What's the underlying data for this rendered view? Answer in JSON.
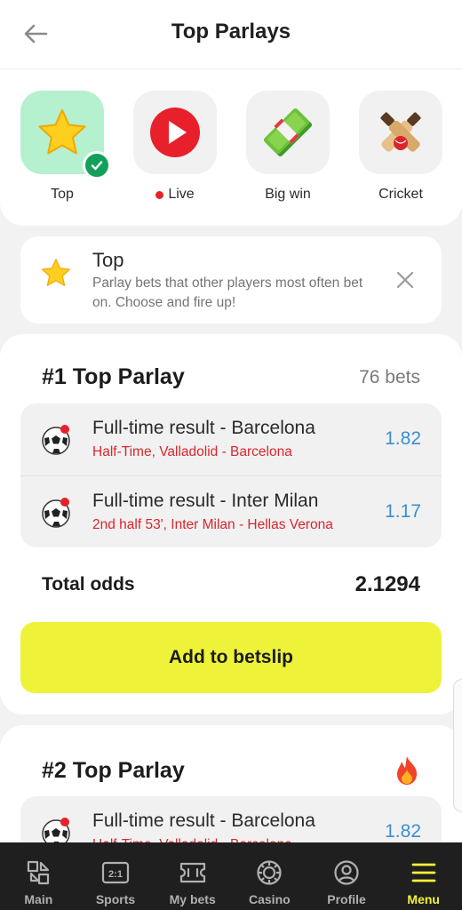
{
  "header": {
    "title": "Top Parlays",
    "back_icon": "arrow-left-icon"
  },
  "categories": [
    {
      "label": "Top",
      "icon": "star-icon",
      "active": true
    },
    {
      "label": "Live",
      "icon": "play-icon",
      "live_dot": true
    },
    {
      "label": "Big win",
      "icon": "money-stack-icon"
    },
    {
      "label": "Cricket",
      "icon": "cricket-icon"
    }
  ],
  "info": {
    "title": "Top",
    "description": "Parlay bets that other players most often bet on. Choose and fire up!",
    "icon": "star-icon"
  },
  "parlays": [
    {
      "title": "#1 Top Parlay",
      "bets_count": "76 bets",
      "bets": [
        {
          "title": "Full-time result - Barcelona",
          "subtitle": "Half-Time, Valladolid - Barcelona",
          "odds": "1.82"
        },
        {
          "title": "Full-time result - Inter Milan",
          "subtitle": "2nd half 53', Inter Milan - Hellas Verona",
          "odds": "1.17"
        }
      ],
      "total_label": "Total odds",
      "total_value": "2.1294",
      "add_label": "Add to betslip"
    },
    {
      "title": "#2 Top Parlay",
      "badge_icon": "fire-icon",
      "bets": [
        {
          "title": "Full-time result - Barcelona",
          "subtitle": "Half-Time, Valladolid - Barcelona",
          "odds": "1.82"
        }
      ]
    }
  ],
  "bottom_nav": [
    {
      "label": "Main",
      "icon": "main-icon"
    },
    {
      "label": "Sports",
      "icon": "sports-icon"
    },
    {
      "label": "My bets",
      "icon": "ticket-icon"
    },
    {
      "label": "Casino",
      "icon": "casino-chip-icon"
    },
    {
      "label": "Profile",
      "icon": "profile-icon"
    },
    {
      "label": "Menu",
      "icon": "menu-icon",
      "active": true
    }
  ],
  "colors": {
    "accent": "#eef33a",
    "odds": "#3a8fd0",
    "live": "#e8202c",
    "active_tile": "#b5f0cf",
    "check": "#12a15a",
    "nav_active": "#f2f23a"
  }
}
